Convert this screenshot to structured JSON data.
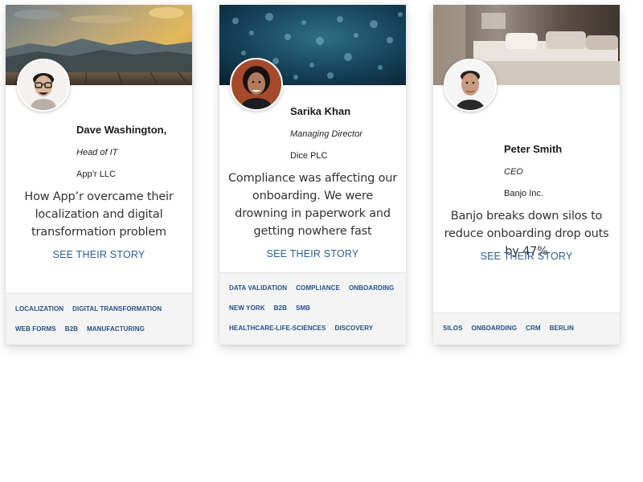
{
  "cards": [
    {
      "name": "Dave Washington,",
      "role": "Head of IT",
      "company": "App’r LLC",
      "quote": "How App’r overcame their localization and digital transformation problem",
      "cta": "SEE THEIR STORY",
      "tags": [
        "LOCALIZATION",
        "DIGITAL TRANSFORMATION",
        "WEB FORMS",
        "B2B",
        "MANUFACTURING"
      ],
      "banner_image": "mountain-sunset",
      "avatar": "man-with-glasses"
    },
    {
      "name": "Sarika Khan",
      "role": "Managing Director",
      "company": "Dice PLC",
      "quote": "Compliance was affecting our onboarding.   We were drowning in paperwork and getting nowhere fast",
      "cta": "SEE THEIR STORY",
      "tags": [
        "DATA VALIDATION",
        "COMPLIANCE",
        "ONBOARDING",
        "NEW YORK",
        "B2B",
        "SMB",
        "HEALTHCARE-LIFE-SCIENCES",
        "DISCOVERY"
      ],
      "banner_image": "blue-bokeh",
      "avatar": "woman-smiling"
    },
    {
      "name": "Peter Smith",
      "role": "CEO",
      "company": "Banjo Inc.",
      "quote": "Banjo breaks down silos to reduce onboarding drop outs by 47%",
      "cta": "SEE THEIR STORY",
      "tags": [
        "SILOS",
        "ONBOARDING",
        "CRM",
        "BERLIN"
      ],
      "banner_image": "bedroom-interior",
      "avatar": "man-portrait"
    }
  ],
  "colors": {
    "link": "#2a5f96",
    "tag": "#22508a",
    "footer_bg": "#f4f4f4"
  }
}
